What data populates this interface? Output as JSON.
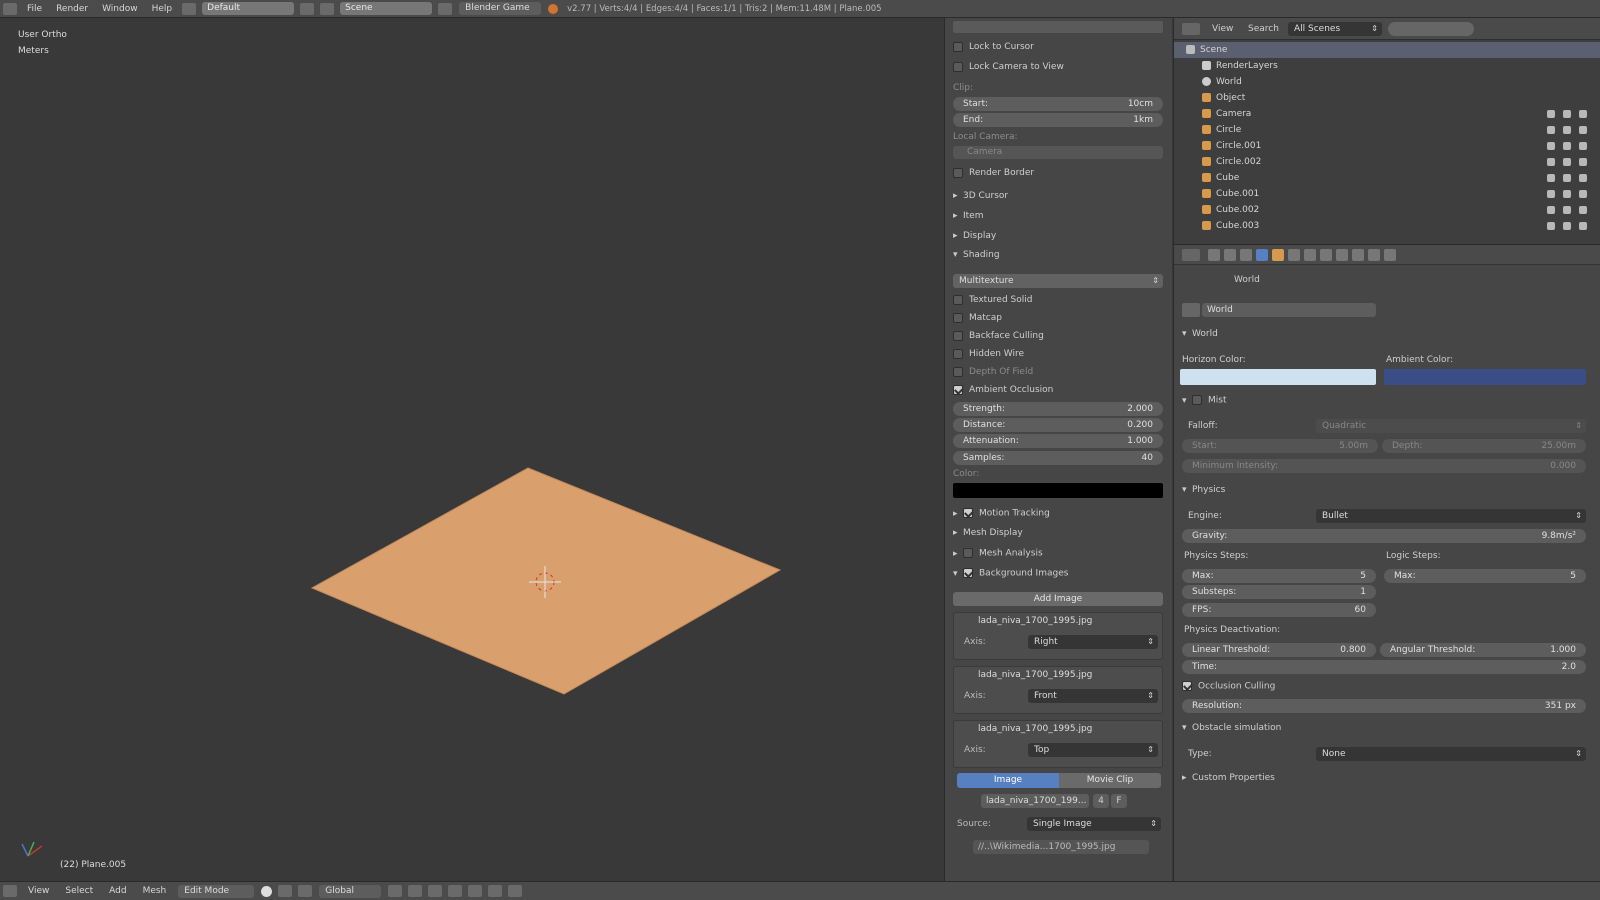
{
  "topbar": {
    "menus": [
      "File",
      "Render",
      "Window",
      "Help"
    ],
    "screen_layout": "Default",
    "scene": "Scene",
    "engine": "Blender Game",
    "stats": "v2.77 | Verts:4/4 | Edges:4/4 | Faces:1/1 | Tris:2 | Mem:11.48M | Plane.005"
  },
  "viewport": {
    "view_name": "User Ortho",
    "units": "Meters",
    "object_info": "(22) Plane.005",
    "plane_color": "#d9a06e"
  },
  "npanel": {
    "lock_to_cursor": "Lock to Cursor",
    "lock_camera": "Lock Camera to View",
    "clip_label": "Clip:",
    "clip_start_label": "Start:",
    "clip_start_value": "10cm",
    "clip_end_label": "End:",
    "clip_end_value": "1km",
    "local_camera_label": "Local Camera:",
    "camera_field": "Camera",
    "render_border": "Render Border",
    "sections_collapsed": [
      "3D Cursor",
      "Item",
      "Display"
    ],
    "shading_label": "Shading",
    "shading_mode": "Multitexture",
    "textured_solid": "Textured Solid",
    "matcap": "Matcap",
    "backface_culling": "Backface Culling",
    "hidden_wire": "Hidden Wire",
    "depth_of_field": "Depth Of Field",
    "ambient_occlusion": "Ambient Occlusion",
    "ao_fields": [
      {
        "label": "Strength:",
        "value": "2.000"
      },
      {
        "label": "Distance:",
        "value": "0.200"
      },
      {
        "label": "Attenuation:",
        "value": "1.000"
      },
      {
        "label": "Samples:",
        "value": "40"
      }
    ],
    "color_label": "Color:",
    "motion_tracking": "Motion Tracking",
    "mesh_display": "Mesh Display",
    "mesh_analysis": "Mesh Analysis",
    "background_images": "Background Images",
    "add_image": "Add Image",
    "bg_images": [
      {
        "file": "lada_niva_1700_1995.jpg",
        "axis_label": "Axis:",
        "axis": "Right"
      },
      {
        "file": "lada_niva_1700_1995.jpg",
        "axis_label": "Axis:",
        "axis": "Front"
      },
      {
        "file": "lada_niva_1700_1995.jpg",
        "axis_label": "Axis:",
        "axis": "Top"
      }
    ],
    "tab_image": "Image",
    "tab_movie": "Movie Clip",
    "image_field": "lada_niva_1700_199...",
    "image_users": "4",
    "image_f": "F",
    "source_label": "Source:",
    "source_value": "Single Image",
    "path_value": "//..\\Wikimedia...1700_1995.jpg"
  },
  "outliner": {
    "menus": [
      "View",
      "Search"
    ],
    "filter": "All Scenes",
    "items": [
      {
        "name": "Scene",
        "depth": 0
      },
      {
        "name": "RenderLayers",
        "depth": 1
      },
      {
        "name": "World",
        "depth": 1
      },
      {
        "name": "Object",
        "depth": 1
      },
      {
        "name": "Camera",
        "depth": 1
      },
      {
        "name": "Circle",
        "depth": 1
      },
      {
        "name": "Circle.001",
        "depth": 1
      },
      {
        "name": "Circle.002",
        "depth": 1
      },
      {
        "name": "Cube",
        "depth": 1
      },
      {
        "name": "Cube.001",
        "depth": 1
      },
      {
        "name": "Cube.002",
        "depth": 1
      },
      {
        "name": "Cube.003",
        "depth": 1
      }
    ]
  },
  "props": {
    "breadcrumb": "World",
    "world_name": "World",
    "world_section": "World",
    "horizon_label": "Horizon Color:",
    "ambient_label": "Ambient Color:",
    "horizon_color": "#cfe0ee",
    "ambient_color": "#3b4d86",
    "mist": "Mist",
    "falloff_label": "Falloff:",
    "falloff_value": "Quadratic",
    "mist_start": "Start:",
    "mist_start_value": "5.00m",
    "mist_depth": "Depth:",
    "mist_depth_value": "25.00m",
    "mist_min_intensity": "Minimum Intensity:",
    "mist_min_value": "0.000",
    "physics": "Physics",
    "engine_label": "Engine:",
    "engine_value": "Bullet",
    "gravity_label": "Gravity:",
    "gravity_value": "9.8m/s²",
    "physics_steps": "Physics Steps:",
    "logic_steps": "Logic Steps:",
    "max_label": "Max:",
    "max_value": "5",
    "logic_max_label": "Max:",
    "logic_max_value": "5",
    "substeps_label": "Substeps:",
    "substeps_value": "1",
    "fps_label": "FPS:",
    "fps_value": "60",
    "physics_deactivation": "Physics Deactivation:",
    "linear_label": "Linear Threshold:",
    "linear_value": "0.800",
    "angular_label": "Angular Threshold:",
    "angular_value": "1.000",
    "time_label": "Time:",
    "time_value": "2.0",
    "occlusion_culling": "Occlusion Culling",
    "resolution_label": "Resolution:",
    "resolution_value": "351 px",
    "obstacle_sim": "Obstacle simulation",
    "type_label": "Type:",
    "type_value": "None",
    "custom_props": "Custom Properties"
  },
  "bottombar": {
    "menus": [
      "View",
      "Select",
      "Add",
      "Mesh"
    ],
    "mode": "Edit Mode",
    "orientation": "Global"
  }
}
